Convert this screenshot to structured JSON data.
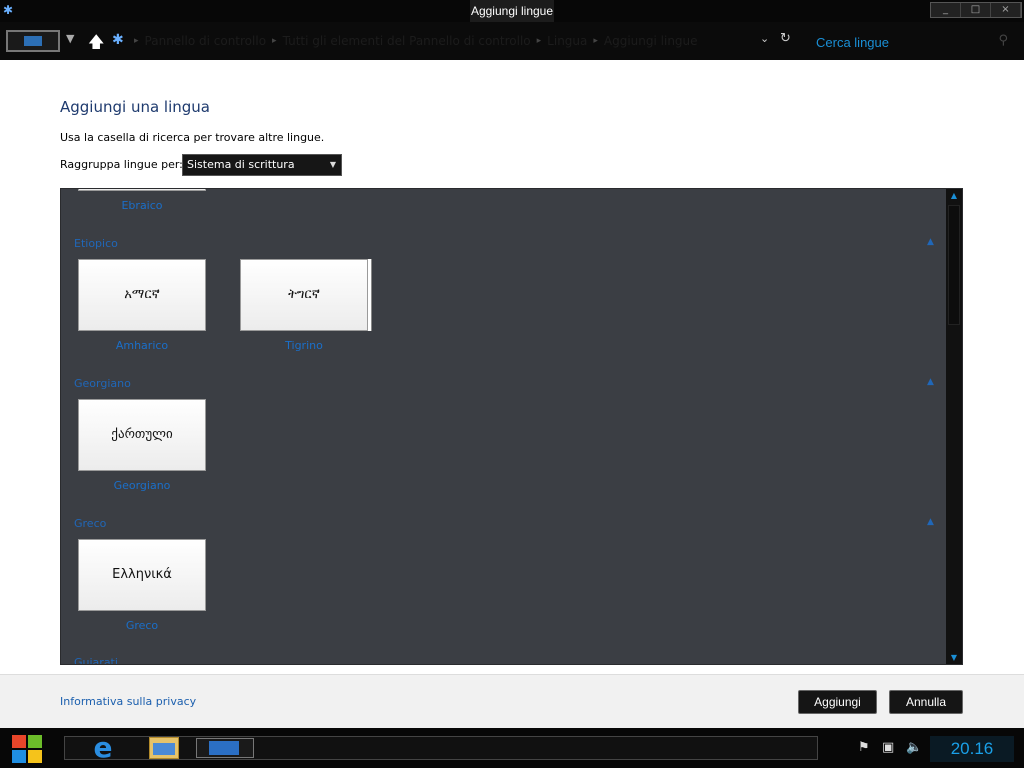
{
  "window": {
    "title": "Aggiungi lingue"
  },
  "address": {
    "breadcrumb": [
      "Pannello di controllo",
      "Tutti gli elementi del Pannello di controllo",
      "Lingua",
      "Aggiungi lingue"
    ],
    "search_placeholder": "Cerca lingue"
  },
  "page": {
    "title": "Aggiungi una lingua",
    "instruction": "Usa la casella di ricerca per trovare altre lingue.",
    "group_label": "Raggruppa lingue per:",
    "group_value": "Sistema di scrittura"
  },
  "languages": {
    "partial_top_label": "Ebraico",
    "groups": [
      {
        "header": "Etiopico",
        "tiles": [
          {
            "native": "አማርኛ",
            "label": "Amharico"
          },
          {
            "native": "ትግርኛ",
            "label": "Tigrino"
          }
        ]
      },
      {
        "header": "Georgiano",
        "tiles": [
          {
            "native": "ქართული",
            "label": "Georgiano"
          }
        ]
      },
      {
        "header": "Greco",
        "tiles": [
          {
            "native": "Ελληνικά",
            "label": "Greco"
          }
        ]
      }
    ],
    "partial_bottom_header": "Gujarati"
  },
  "footer": {
    "privacy": "Informativa sulla privacy",
    "add": "Aggiungi",
    "cancel": "Annulla"
  },
  "taskbar": {
    "clock": "20.16"
  },
  "colors": {
    "accent": "#1a8fd6",
    "panel": "#3b3e44",
    "link": "#1b6fc9"
  }
}
